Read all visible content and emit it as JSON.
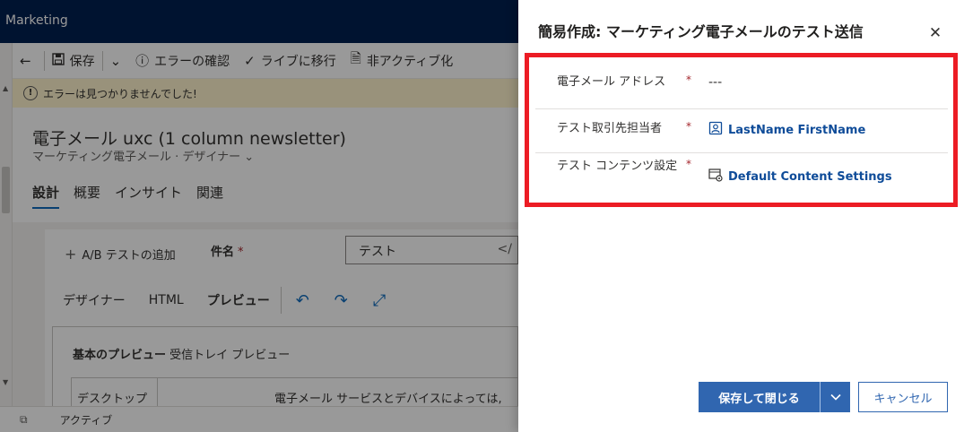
{
  "app": {
    "name": "Marketing"
  },
  "commandbar": {
    "back_icon": "back-arrow-icon",
    "save_label": "保存",
    "check_errors_label": "エラーの確認",
    "go_live_label": "ライブに移行",
    "deactivate_label": "非アクティブ化"
  },
  "warning": {
    "text": "エラーは見つかりませんでした!"
  },
  "record": {
    "title": "電子メール uxc (1 column newsletter)",
    "subtitle": "マーケティング電子メール · デザイナー",
    "tabs": [
      "設計",
      "概要",
      "インサイト",
      "関連"
    ]
  },
  "form": {
    "ab_add_label": "A/B テストの追加",
    "subject_label": "件名",
    "subject_required": "*",
    "subject_value": "テスト",
    "subject_tag": "</",
    "designer_tabs": [
      "デザイナー",
      "HTML",
      "プレビュー"
    ],
    "preview_title_bold": "基本のプレビュー",
    "preview_title_rest": "受信トレイ プレビュー",
    "preview_cell": "デスクトップ",
    "preview_text": "電子メール サービスとデバイスによっては,"
  },
  "statusbar": {
    "status": "アクティブ"
  },
  "panel": {
    "title": "簡易作成: マーケティング電子メールのテスト送信",
    "close_icon": "close-icon",
    "fields": [
      {
        "label": "電子メール アドレス",
        "required": "*",
        "value": "---"
      },
      {
        "label": "テスト取引先担当者",
        "required": "*",
        "value": "LastName FirstName",
        "icon": "contact-icon"
      },
      {
        "label": "テスト コンテンツ設定",
        "required": "*",
        "value": "Default Content Settings",
        "icon": "content-settings-icon"
      }
    ],
    "save_close_label": "保存して閉じる",
    "cancel_label": "キャンセル"
  },
  "colors": {
    "highlight": "#ec1c24",
    "primary": "#3066b0",
    "topbar": "#002050"
  }
}
